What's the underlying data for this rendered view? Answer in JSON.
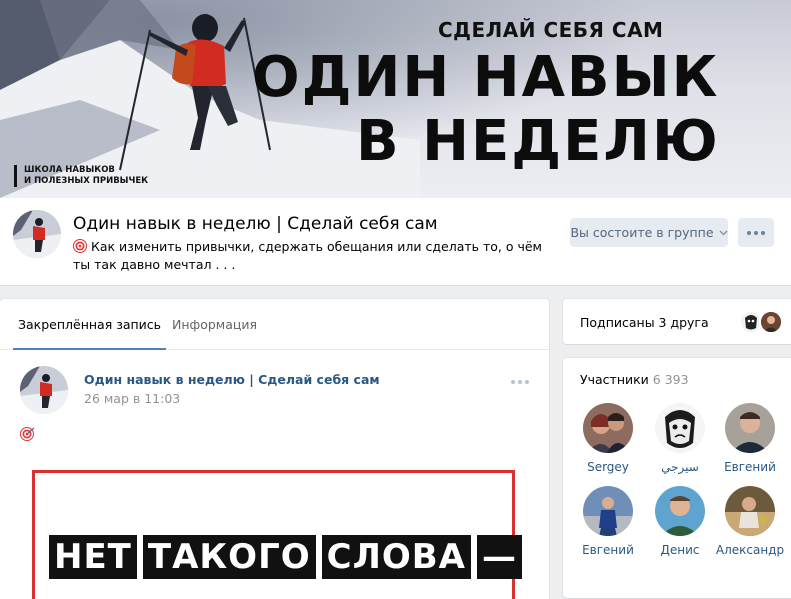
{
  "cover": {
    "tagline": "СДЕЛАЙ СЕБЯ САМ",
    "headline_line1": "ОДИН НАВЫК",
    "headline_line2": "В НЕДЕЛЮ",
    "school_line1": "ШКОЛА НАВЫКОВ",
    "school_line2": "И ПОЛЕЗНЫХ ПРИВЫЧЕК"
  },
  "group": {
    "name": "Один навык в неделю | Сделай себя сам",
    "status_icon": "target-icon",
    "status": "Как изменить привычки, сдержать обещания или сделать то, о чём ты так давно мечтал . . .",
    "member_button": "Вы состоите в группе"
  },
  "tabs": [
    {
      "label": "Закреплённая запись",
      "active": true
    },
    {
      "label": "Информация",
      "active": false
    }
  ],
  "post": {
    "author": "Один навык в неделю | Сделай себя сам",
    "date": "26 мар в 11:03",
    "emoji": "target-icon",
    "image_text": [
      "НЕТ",
      "ТАКОГО",
      "СЛОВА",
      "—"
    ],
    "accent_color": "#d8322f"
  },
  "friends": {
    "label": "Подписаны 3 друга"
  },
  "members": {
    "title": "Участники",
    "count": "6 393",
    "list": [
      {
        "name": "Sergey"
      },
      {
        "name": "سيرجي"
      },
      {
        "name": "Евгений"
      },
      {
        "name": "Евгений"
      },
      {
        "name": "Денис"
      },
      {
        "name": "Александр"
      }
    ]
  },
  "colors": {
    "background": "#edeef0",
    "link": "#2a5885",
    "button_bg": "#e5ebf1",
    "button_text": "#55677d",
    "tab_underline": "#5181b8"
  }
}
